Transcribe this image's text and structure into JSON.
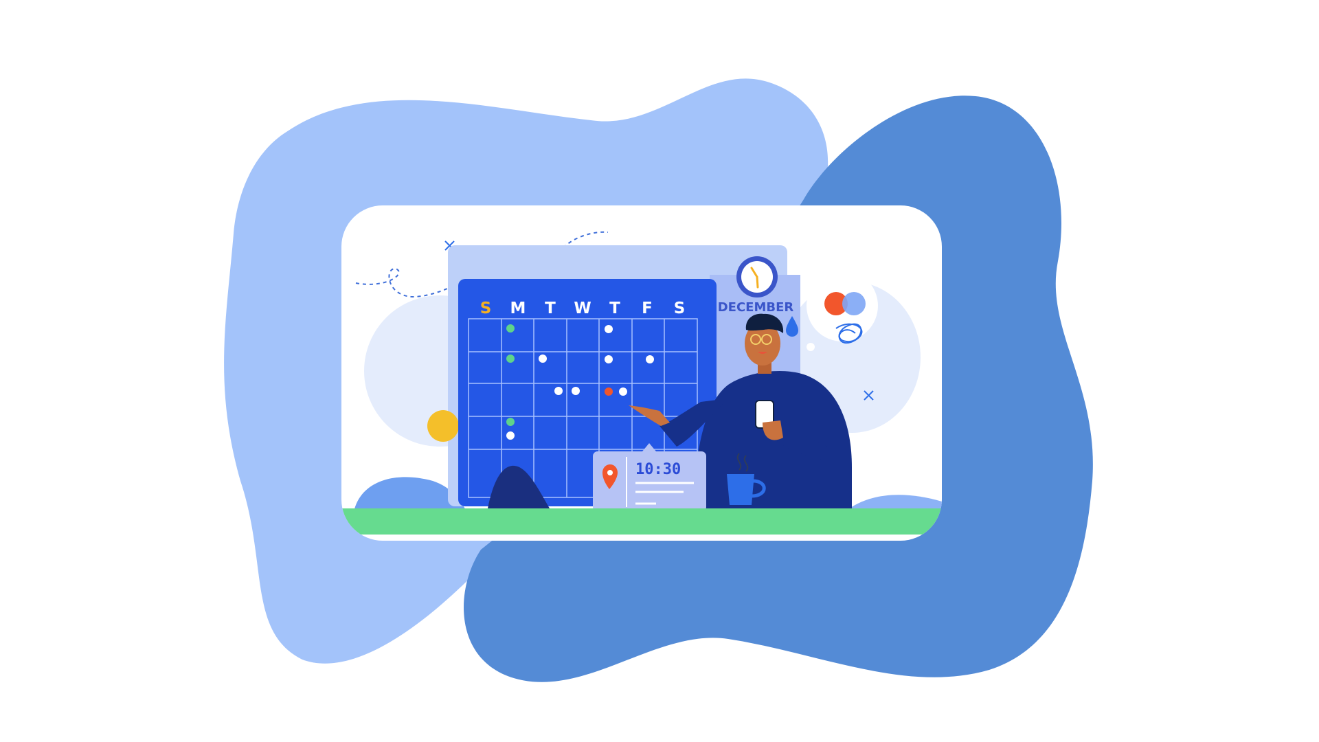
{
  "calendar": {
    "month": "DECEMBER",
    "weekdays": [
      "S",
      "M",
      "T",
      "W",
      "T",
      "F",
      "S"
    ],
    "colors": {
      "grid": "#2457e6",
      "sunday": "#f5b021",
      "dot_default": "#ffffff",
      "dot_done": "#5fd38a",
      "dot_selected": "#f2562c"
    }
  },
  "event_card": {
    "time": "10:30",
    "icon": "location-pin-icon"
  },
  "icons": {
    "clock": "clock-icon",
    "phone": "smartphone-icon",
    "mug": "coffee-mug-icon",
    "thought": "thought-bubble-icon"
  },
  "palette": {
    "blob_light": "#a3c3fa",
    "blob_dark": "#548bd6",
    "card_bg": "#ffffff",
    "ground": "#66db8f",
    "sun": "#f4bf2a",
    "shirt": "#16308a"
  }
}
